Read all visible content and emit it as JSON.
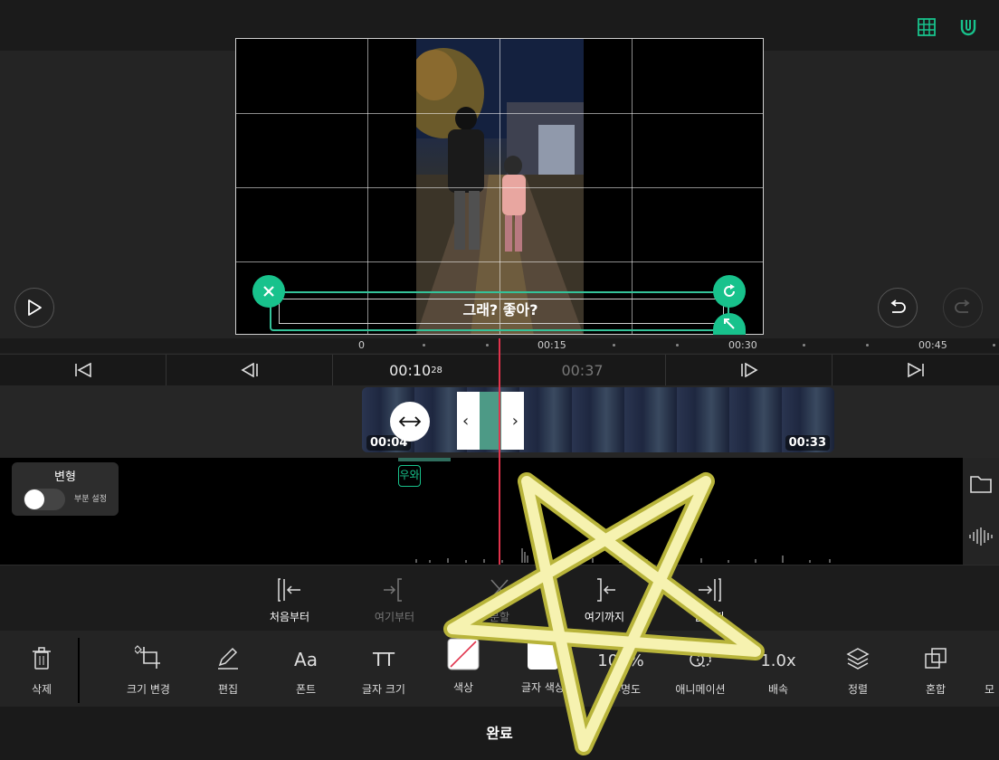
{
  "preview": {
    "subtitle_text": "그래? 좋아?"
  },
  "ruler": {
    "labels": [
      "0",
      "00:15",
      "00:30",
      "00:45"
    ]
  },
  "transport": {
    "current_time": "00:10",
    "current_frames": "28",
    "total_time": "00:37"
  },
  "clip": {
    "start_label": "00:04",
    "end_label": "00:33"
  },
  "text_layer": {
    "label": "우와"
  },
  "transform_panel": {
    "title": "변형",
    "toggle_label": "부분 설정",
    "toggle_on": false
  },
  "split_tools": [
    {
      "label": "처음부터",
      "enabled": true
    },
    {
      "label": "여기부터",
      "enabled": false
    },
    {
      "label": "분할",
      "enabled": false
    },
    {
      "label": "여기까지",
      "enabled": true
    },
    {
      "label": "끝까지",
      "enabled": true
    }
  ],
  "toolbar": {
    "delete": "삭제",
    "resize": "크기 변경",
    "edit": "편집",
    "font": "폰트",
    "font_icon": "Aa",
    "text_size": "글자 크기",
    "text_size_icon": "TT",
    "color": "색상",
    "text_color": "글자 색상",
    "opacity": "불투명도",
    "opacity_value": "100%",
    "animation": "애니메이션",
    "speed": "배속",
    "speed_value": "1.0x",
    "align": "정렬",
    "blend": "혼합",
    "more": "모"
  },
  "done_label": "완료",
  "colors": {
    "accent": "#18c28c",
    "playhead": "#e0334c",
    "star_fill": "#f6f2b0",
    "star_outline": "#b8b43a"
  }
}
